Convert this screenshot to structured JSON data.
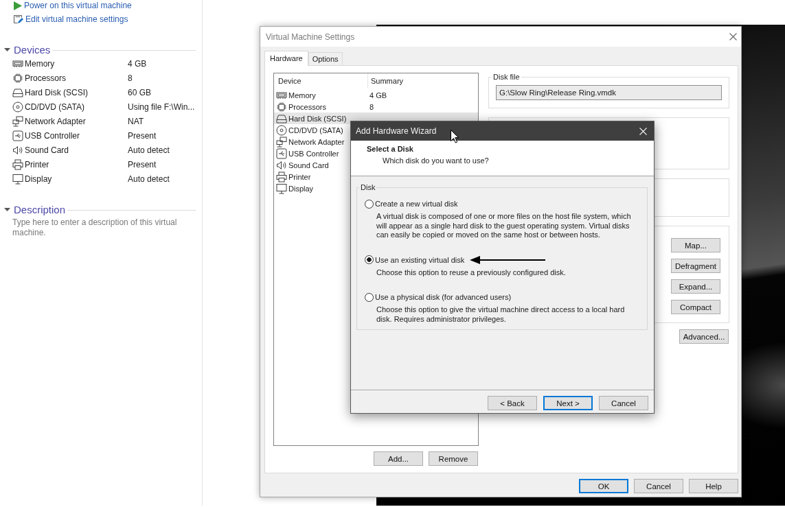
{
  "sidebar": {
    "actions": [
      {
        "kind": "power",
        "label": "Power on this virtual machine"
      },
      {
        "kind": "edit",
        "label": "Edit virtual machine settings"
      }
    ],
    "devices_section": {
      "title": "Devices",
      "expanded": true,
      "devices": [
        {
          "kind": "memory",
          "name": "Memory",
          "summary": "4 GB"
        },
        {
          "kind": "processor",
          "name": "Processors",
          "summary": "8"
        },
        {
          "kind": "harddisk",
          "name": "Hard Disk (SCSI)",
          "summary": "60 GB"
        },
        {
          "kind": "cdrom",
          "name": "CD/DVD (SATA)",
          "summary": "Using file F:\\Win..."
        },
        {
          "kind": "network",
          "name": "Network Adapter",
          "summary": "NAT"
        },
        {
          "kind": "usb",
          "name": "USB Controller",
          "summary": "Present"
        },
        {
          "kind": "sound",
          "name": "Sound Card",
          "summary": "Auto detect"
        },
        {
          "kind": "printer",
          "name": "Printer",
          "summary": "Present"
        },
        {
          "kind": "display",
          "name": "Display",
          "summary": "Auto detect"
        }
      ]
    },
    "description_section": {
      "title": "Description",
      "expanded": true,
      "placeholder": "Type here to enter a description of this virtual machine."
    }
  },
  "settings_dialog": {
    "title": "Virtual Machine Settings",
    "tabs": [
      {
        "label": "Hardware",
        "selected": true
      },
      {
        "label": "Options",
        "selected": false
      }
    ],
    "device_list": {
      "columns": [
        "Device",
        "Summary"
      ],
      "rows": [
        {
          "kind": "memory",
          "name": "Memory",
          "summary": "4 GB",
          "selected": false
        },
        {
          "kind": "processor",
          "name": "Processors",
          "summary": "8",
          "selected": false
        },
        {
          "kind": "harddisk",
          "name": "Hard Disk (SCSI)",
          "selected": true
        },
        {
          "kind": "cdrom",
          "name": "CD/DVD (SATA)",
          "selected": false
        },
        {
          "kind": "network",
          "name": "Network Adapter",
          "selected": false
        },
        {
          "kind": "usb",
          "name": "USB Controller",
          "selected": false
        },
        {
          "kind": "sound",
          "name": "Sound Card",
          "selected": false
        },
        {
          "kind": "printer",
          "name": "Printer",
          "selected": false
        },
        {
          "kind": "display",
          "name": "Display",
          "selected": false
        }
      ]
    },
    "list_buttons": [
      "Add...",
      "Remove"
    ],
    "disk_file": {
      "title": "Disk file",
      "value": "G:\\Slow Ring\\Release Ring.vmdk"
    },
    "disk_utility_buttons": [
      "Map...",
      "Defragment",
      "Expand...",
      "Compact"
    ],
    "advanced_button": "Advanced...",
    "buttons": [
      {
        "label": "OK",
        "default": true
      },
      {
        "label": "Cancel",
        "default": false
      },
      {
        "label": "Help",
        "default": false
      }
    ]
  },
  "wizard": {
    "title": "Add Hardware Wizard",
    "heading": "Select a Disk",
    "subheading": "Which disk do you want to use?",
    "group_title": "Disk",
    "options": [
      {
        "label": "Create a new virtual disk",
        "description": "A virtual disk is composed of one or more files on the host file system, which will appear as a single hard disk to the guest operating system. Virtual disks can easily be copied or moved on the same host or between hosts.",
        "selected": false,
        "annotated": false
      },
      {
        "label": "Use an existing virtual disk",
        "description": "Choose this option to reuse a previously configured disk.",
        "selected": true,
        "annotated": true
      },
      {
        "label": "Use a physical disk (for advanced users)",
        "description": "Choose this option to give the virtual machine direct access to a local hard disk. Requires administrator privileges.",
        "selected": false,
        "annotated": false
      }
    ],
    "buttons": [
      {
        "label": "< Back",
        "default": false
      },
      {
        "label": "Next >",
        "default": true
      },
      {
        "label": "Cancel",
        "default": false
      }
    ]
  }
}
